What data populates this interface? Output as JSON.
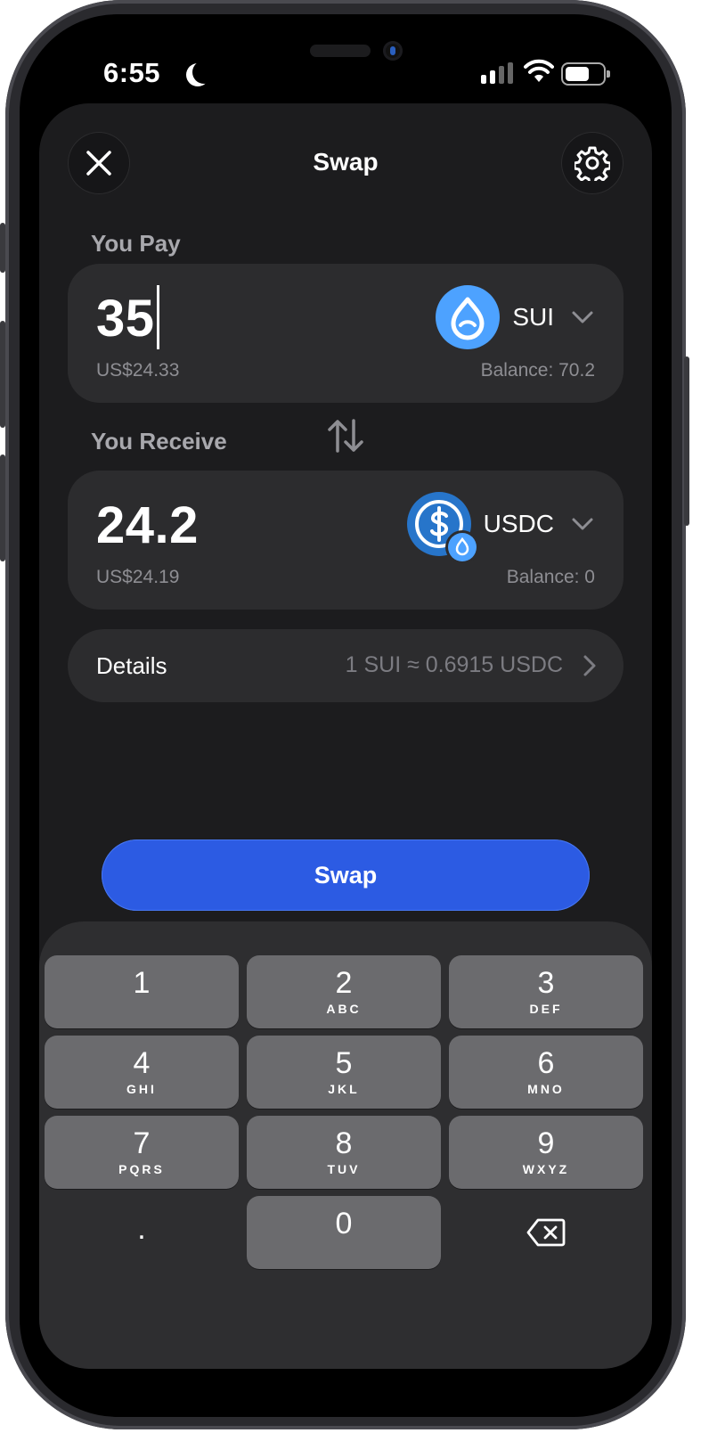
{
  "status_bar": {
    "time": "6:55"
  },
  "header": {
    "title": "Swap"
  },
  "pay": {
    "label": "You Pay",
    "amount": "35",
    "fiat": "US$24.33",
    "token": "SUI",
    "balance": "Balance: 70.2"
  },
  "receive": {
    "label": "You Receive",
    "amount": "24.2",
    "fiat": "US$24.19",
    "token": "USDC",
    "balance": "Balance: 0"
  },
  "details": {
    "label": "Details",
    "rate": "1 SUI ≈ 0.6915 USDC"
  },
  "swap_button": {
    "label": "Swap"
  },
  "keypad": {
    "keys": [
      {
        "digit": "1",
        "letters": ""
      },
      {
        "digit": "2",
        "letters": "ABC"
      },
      {
        "digit": "3",
        "letters": "DEF"
      },
      {
        "digit": "4",
        "letters": "GHI"
      },
      {
        "digit": "5",
        "letters": "JKL"
      },
      {
        "digit": "6",
        "letters": "MNO"
      },
      {
        "digit": "7",
        "letters": "PQRS"
      },
      {
        "digit": "8",
        "letters": "TUV"
      },
      {
        "digit": "9",
        "letters": "WXYZ"
      },
      {
        "digit": ".",
        "letters": ""
      },
      {
        "digit": "0",
        "letters": ""
      }
    ]
  },
  "colors": {
    "accent": "#2c5be3",
    "sui": "#4da2ff",
    "usdc": "#2775ca",
    "card": "#2c2c2e",
    "key": "#6b6b6e"
  },
  "icons": {
    "close": "close-icon",
    "settings": "gear-icon",
    "swap_direction": "swap-arrows-icon",
    "backspace": "backspace-icon"
  }
}
